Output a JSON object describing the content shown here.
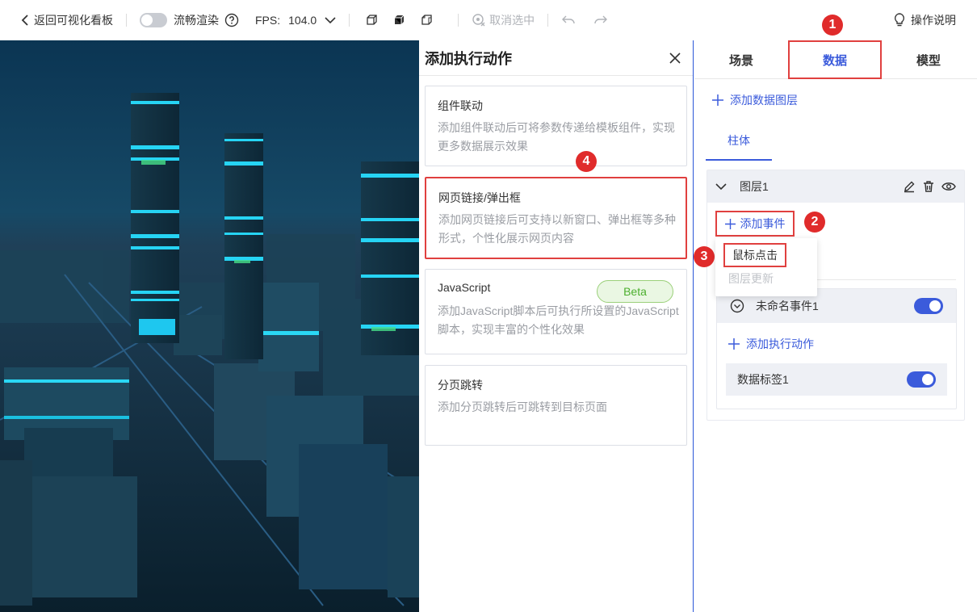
{
  "toolbar": {
    "back_label": "返回可视化看板",
    "smooth_render_label": "流畅渲染",
    "fps_label": "FPS:",
    "fps_value": "104.0",
    "cancel_select_label": "取消选中",
    "guide_label": "操作说明"
  },
  "action_panel": {
    "title": "添加执行动作",
    "cards": [
      {
        "title": "组件联动",
        "desc": "添加组件联动后可将参数传递给模板组件，实现更多数据展示效果"
      },
      {
        "title": "网页链接/弹出框",
        "desc": "添加网页链接后可支持以新窗口、弹出框等多种形式，个性化展示网页内容"
      },
      {
        "title": "JavaScript",
        "desc": "添加JavaScript脚本后可执行所设置的JavaScript脚本，实现丰富的个性化效果",
        "badge": "Beta"
      },
      {
        "title": "分页跳转",
        "desc": "添加分页跳转后可跳转到目标页面"
      }
    ]
  },
  "right_panel": {
    "tabs": [
      "场景",
      "数据",
      "模型"
    ],
    "active_tab": "数据",
    "add_data_layer_label": "添加数据图层",
    "sub_tab": "柱体",
    "layer_name": "图层1",
    "add_event_label": "添加事件",
    "event_menu": [
      "鼠标点击",
      "图层更新"
    ],
    "event_name": "未命名事件1",
    "event_enabled": true,
    "add_exec_label": "添加执行动作",
    "data_tag_label": "数据标签1",
    "data_tag_enabled": true
  },
  "annotations": [
    "1",
    "2",
    "3",
    "4"
  ],
  "colors": {
    "accent": "#3b5bdb",
    "highlight": "#e0403f",
    "badge": "#e02b2b"
  }
}
